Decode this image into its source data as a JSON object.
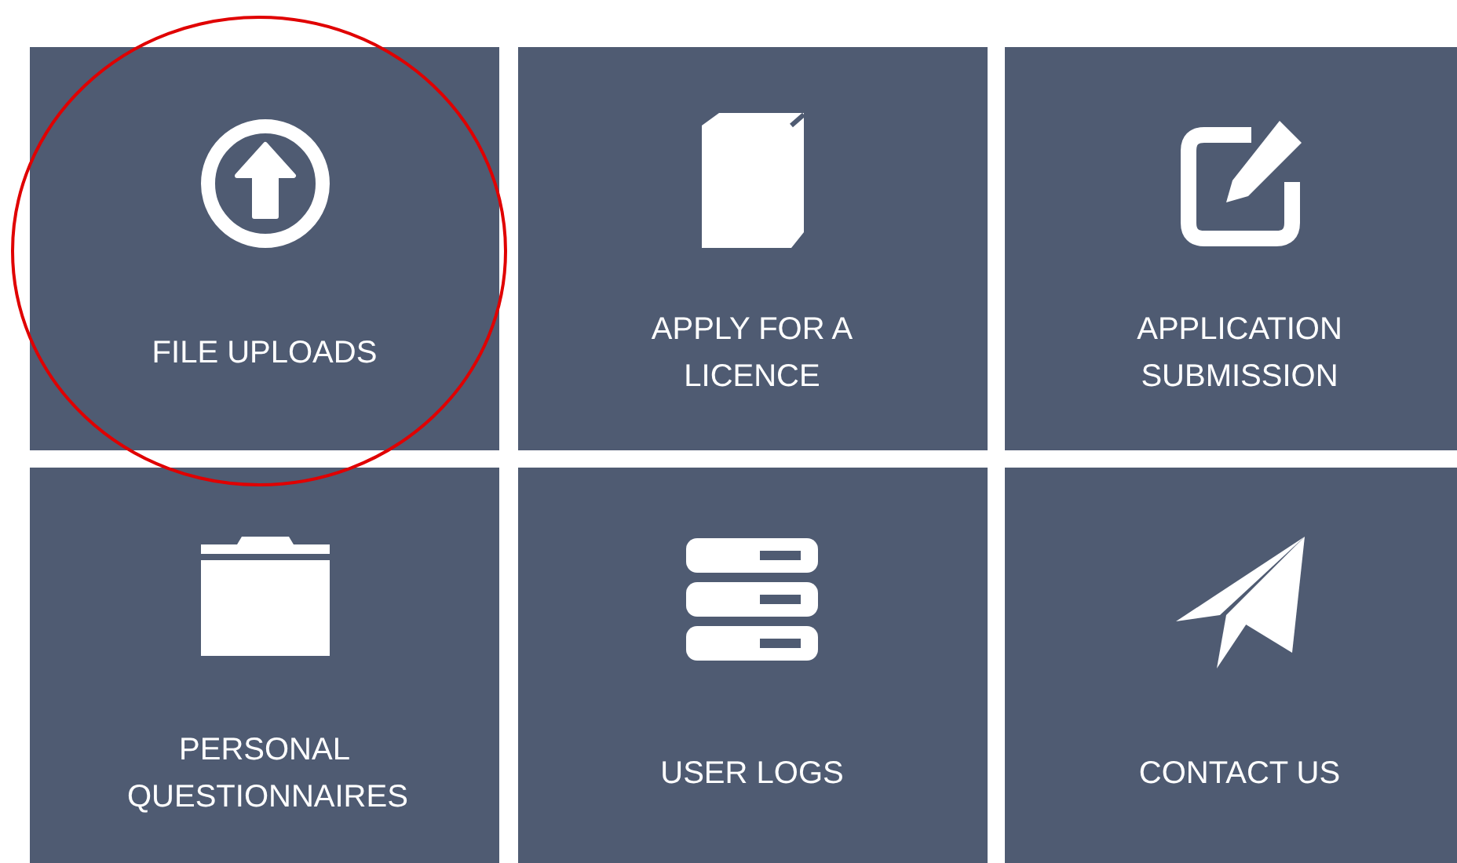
{
  "tiles": [
    {
      "label": "FILE UPLOADS",
      "kind": "upload",
      "highlighted": true
    },
    {
      "label": "APPLY FOR A LICENCE",
      "kind": "book",
      "highlighted": false
    },
    {
      "label": "APPLICATION SUBMISSION",
      "kind": "edit",
      "highlighted": false
    },
    {
      "label": "PERSONAL QUESTIONNAIRES",
      "kind": "folder",
      "highlighted": false
    },
    {
      "label": "USER LOGS",
      "kind": "server",
      "highlighted": false
    },
    {
      "label": "CONTACT US",
      "kind": "plane",
      "highlighted": false
    }
  ]
}
